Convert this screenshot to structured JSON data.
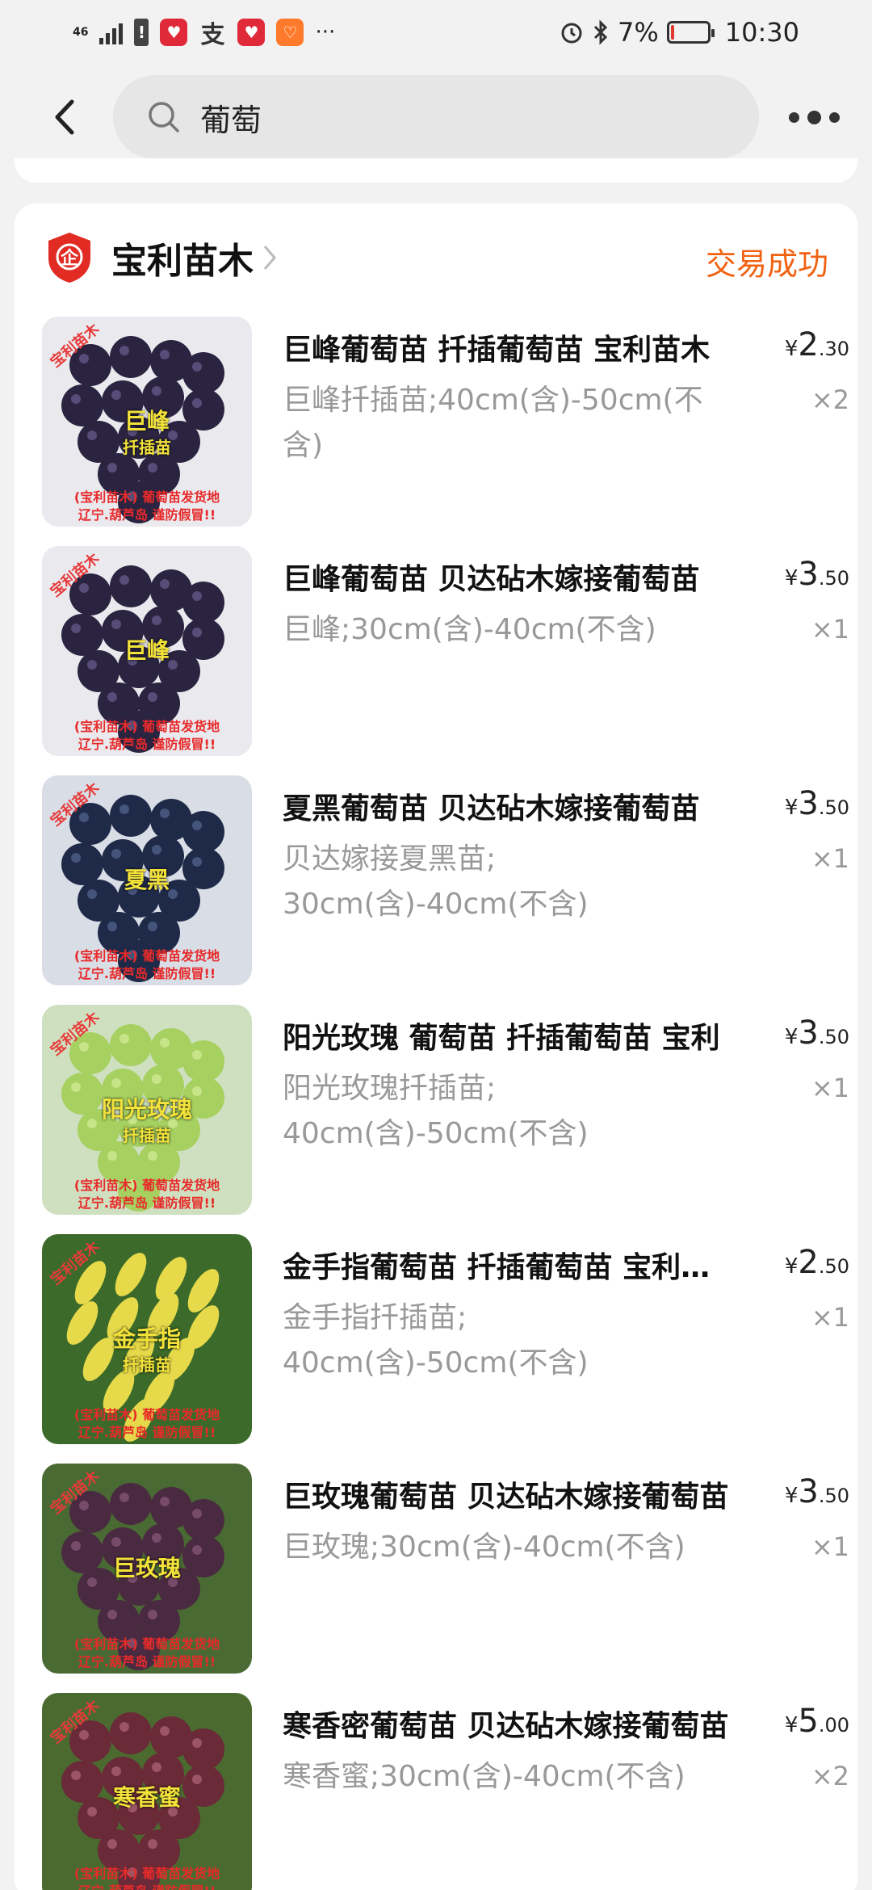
{
  "status_bar": {
    "network": "46",
    "battery_percent": "7%",
    "battery_level": 0.07,
    "time": "10:30",
    "more": "···"
  },
  "search": {
    "query": "葡萄"
  },
  "order": {
    "shop_name": "宝利苗木",
    "shop_badge": "企",
    "status": "交易成功",
    "items": [
      {
        "title": "巨峰葡萄苗 扦插葡萄苗  宝利苗木",
        "spec": "巨峰扦插苗;40cm(含)-50cm(不含)",
        "currency": "¥",
        "price_int": "2",
        "price_dec": ".30",
        "qty": "×2",
        "image_label": "巨峰",
        "image_sub": "扦插苗",
        "grape": "dark"
      },
      {
        "title": "巨峰葡萄苗 贝达砧木嫁接葡萄苗",
        "spec": "巨峰;30cm(含)-40cm(不含)",
        "currency": "¥",
        "price_int": "3",
        "price_dec": ".50",
        "qty": "×1",
        "image_label": "巨峰",
        "image_sub": "",
        "grape": "dark"
      },
      {
        "title": "夏黑葡萄苗  贝达砧木嫁接葡萄苗",
        "spec": "贝达嫁接夏黑苗;\n30cm(含)-40cm(不含)",
        "currency": "¥",
        "price_int": "3",
        "price_dec": ".50",
        "qty": "×1",
        "image_label": "夏黑",
        "image_sub": "",
        "grape": "blue"
      },
      {
        "title": "阳光玫瑰 葡萄苗 扦插葡萄苗 宝利",
        "spec": "阳光玫瑰扦插苗;\n40cm(含)-50cm(不含)",
        "currency": "¥",
        "price_int": "3",
        "price_dec": ".50",
        "qty": "×1",
        "image_label": "阳光玫瑰",
        "image_sub": "扦插苗",
        "grape": "green"
      },
      {
        "title": "金手指葡萄苗 扦插葡萄苗  宝利苗木",
        "spec": "金手指扦插苗;\n40cm(含)-50cm(不含)",
        "currency": "¥",
        "price_int": "2",
        "price_dec": ".50",
        "qty": "×1",
        "image_label": "金手指",
        "image_sub": "扦插苗",
        "grape": "yellow"
      },
      {
        "title": "巨玫瑰葡萄苗 贝达砧木嫁接葡萄苗",
        "spec": "巨玫瑰;30cm(含)-40cm(不含)",
        "currency": "¥",
        "price_int": "3",
        "price_dec": ".50",
        "qty": "×1",
        "image_label": "巨玫瑰",
        "image_sub": "",
        "grape": "purple"
      },
      {
        "title": "寒香密葡萄苗  贝达砧木嫁接葡萄苗",
        "spec": "寒香蜜;30cm(含)-40cm(不含)",
        "currency": "¥",
        "price_int": "5",
        "price_dec": ".00",
        "qty": "×2",
        "image_label": "寒香蜜",
        "image_sub": "",
        "grape": "red"
      }
    ],
    "image_watermark": "宝利苗木",
    "image_caption_1": "(宝利苗木) 葡萄苗发货地",
    "image_caption_2": "辽宁.葫芦岛 谨防假冒!!"
  },
  "colors": {
    "accent": "#f06212",
    "shop_badge": "#e12b23"
  }
}
